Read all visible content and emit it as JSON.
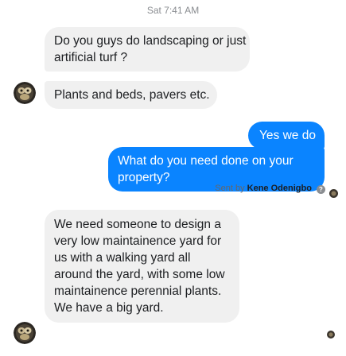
{
  "thread": {
    "timestamp": "Sat 7:41 AM",
    "messages": [
      {
        "sender": "other",
        "lines": [
          "Do you guys do landscaping or just",
          "artificial turf ?"
        ]
      },
      {
        "sender": "other",
        "lines": [
          "Plants and beds, pavers etc."
        ]
      },
      {
        "sender": "me",
        "lines": [
          "Yes we do"
        ]
      },
      {
        "sender": "me",
        "lines": [
          "What do you need done on your",
          "property?"
        ]
      },
      {
        "sender": "other",
        "lines": [
          "We need someone to design a",
          "very low maintainence yard for",
          "us with a walking yard all",
          "around the yard, with some low",
          "maintainence perennial plants.",
          "We have a big yard."
        ]
      }
    ],
    "sent_by": {
      "prefix": "Sent by",
      "name": "Kene Odenigbo",
      "icon": "info-icon"
    }
  },
  "colors": {
    "outgoing_bubble": "#0a84ff",
    "incoming_bubble": "#f0f0f0",
    "outgoing_text": "#ffffff",
    "incoming_text": "#1c1e21",
    "meta_text": "#8a8d91"
  },
  "icons": {
    "contact_avatar": "contact-avatar",
    "seen_indicator": "seen-avatar-dot"
  }
}
